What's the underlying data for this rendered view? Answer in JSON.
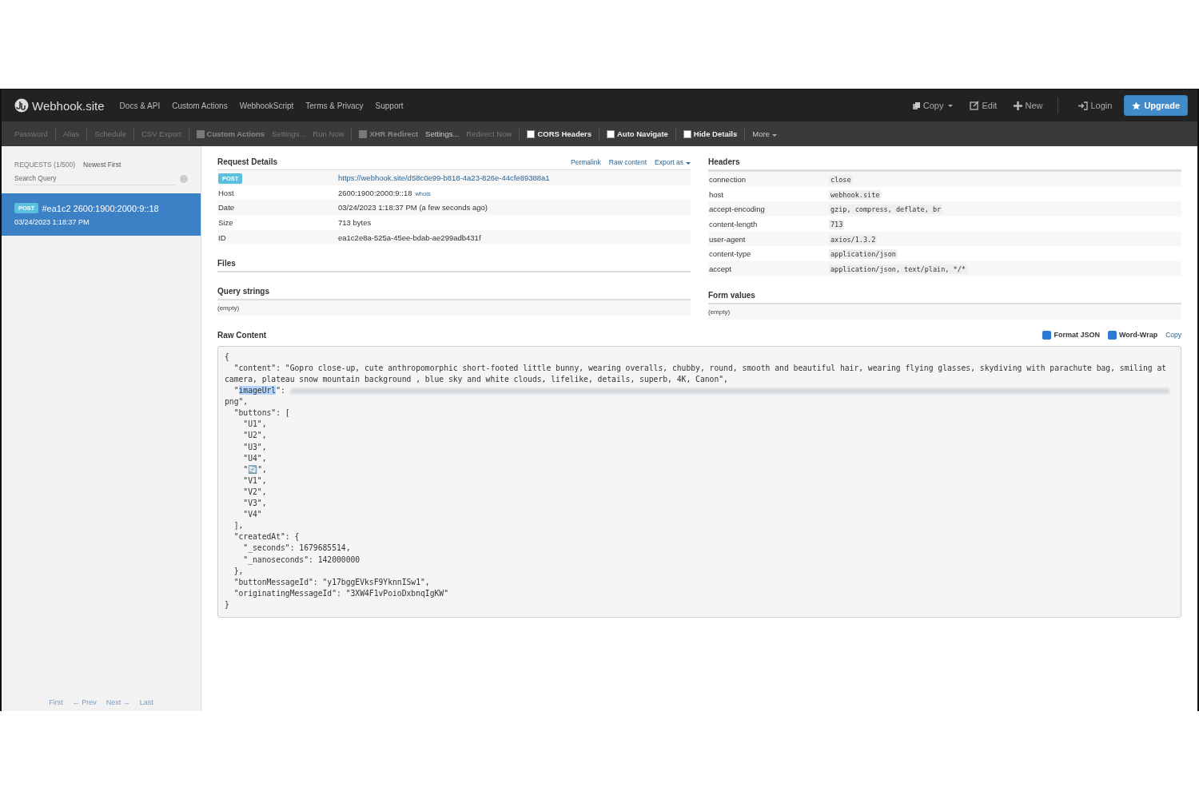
{
  "navbar": {
    "brand": "Webhook.site",
    "links": [
      "Docs & API",
      "Custom Actions",
      "WebhookScript",
      "Terms & Privacy",
      "Support"
    ],
    "actions": [
      {
        "kind": "copy",
        "label": "Copy",
        "caret": true
      },
      {
        "kind": "edit",
        "label": "Edit",
        "caret": false
      },
      {
        "kind": "new",
        "label": "New",
        "caret": false
      },
      {
        "kind": "login",
        "label": "Login",
        "caret": false
      }
    ],
    "upgrade": "Upgrade"
  },
  "toolbar": [
    {
      "kind": "link",
      "label": "Password",
      "disabled": true
    },
    {
      "kind": "sep"
    },
    {
      "kind": "link",
      "label": "Alias",
      "disabled": true
    },
    {
      "kind": "sep"
    },
    {
      "kind": "link",
      "label": "Schedule",
      "disabled": true
    },
    {
      "kind": "sep"
    },
    {
      "kind": "link",
      "label": "CSV Export",
      "disabled": true
    },
    {
      "kind": "sep"
    },
    {
      "kind": "checkbox",
      "label": "Custom Actions",
      "checked": false,
      "disabled": true
    },
    {
      "kind": "link",
      "label": "Settings...",
      "disabled": true
    },
    {
      "kind": "link",
      "label": "Run Now",
      "disabled": true
    },
    {
      "kind": "sep"
    },
    {
      "kind": "checkbox",
      "label": "XHR Redirect",
      "checked": false,
      "disabled": true
    },
    {
      "kind": "link",
      "label": "Settings...",
      "disabled": false
    },
    {
      "kind": "link",
      "label": "Redirect Now",
      "disabled": true
    },
    {
      "kind": "sep"
    },
    {
      "kind": "checkbox",
      "label": "CORS Headers",
      "checked": false,
      "disabled": false
    },
    {
      "kind": "sep"
    },
    {
      "kind": "checkbox",
      "label": "Auto Navigate",
      "checked": false,
      "disabled": false
    },
    {
      "kind": "sep"
    },
    {
      "kind": "checkbox",
      "label": "Hide Details",
      "checked": false,
      "disabled": false
    },
    {
      "kind": "sep"
    },
    {
      "kind": "dropdown",
      "label": "More",
      "disabled": false
    }
  ],
  "sidebar": {
    "count": "REQUESTS (1/500)",
    "sort": "Newest First",
    "search": {
      "placeholder": "Search Query"
    },
    "requests": [
      {
        "method": "POST",
        "title": "#ea1c2 2600:1900:2000:9::18",
        "time": "03/24/2023 1:18:37 PM",
        "selected": true
      }
    ],
    "pager": [
      "First",
      "← Prev",
      "Next →",
      "Last"
    ]
  },
  "request_details": {
    "title": "Request Details",
    "links": [
      {
        "label": "Permalink",
        "caret": false
      },
      {
        "label": "Raw content",
        "caret": false
      },
      {
        "label": "Export as",
        "caret": true
      }
    ],
    "method": "POST",
    "url": "https://webhook.site/d58c0e99-b818-4a23-826e-44cfe89388a1",
    "rows": [
      {
        "label": "Host",
        "value": "2600:1900:2000:9::18",
        "link": "whois"
      },
      {
        "label": "Date",
        "value": "03/24/2023 1:18:37 PM (a few seconds ago)"
      },
      {
        "label": "Size",
        "value": "713 bytes"
      },
      {
        "label": "ID",
        "value": "ea1c2e8a-525a-45ee-bdab-ae299adb431f"
      }
    ]
  },
  "files": {
    "title": "Files"
  },
  "query_strings": {
    "title": "Query strings",
    "empty": "(empty)"
  },
  "headers": {
    "title": "Headers",
    "rows": [
      {
        "name": "connection",
        "value": "close"
      },
      {
        "name": "host",
        "value": "webhook.site"
      },
      {
        "name": "accept-encoding",
        "value": "gzip, compress, deflate, br"
      },
      {
        "name": "content-length",
        "value": "713"
      },
      {
        "name": "user-agent",
        "value": "axios/1.3.2"
      },
      {
        "name": "content-type",
        "value": "application/json"
      },
      {
        "name": "accept",
        "value": "application/json, text/plain, */*"
      }
    ]
  },
  "form_values": {
    "title": "Form values",
    "empty": "(empty)"
  },
  "raw_content": {
    "title": "Raw Content",
    "options": [
      {
        "label": "Format JSON",
        "checked": true
      },
      {
        "label": "Word-Wrap",
        "checked": true
      }
    ],
    "copy": "Copy",
    "lines": [
      {
        "kind": "text",
        "text": "{"
      },
      {
        "kind": "text",
        "text": "  \"content\": \"Gopro close-up, cute anthropomorphic short-footed little bunny, wearing overalls, chubby, round, smooth and beautiful hair, wearing flying glasses, skydiving with parachute bag, smiling at camera, plateau snow mountain background , blue sky and white clouds, lifelike, details, superb, 4K, Canon\","
      },
      {
        "kind": "redacted",
        "pre": "  \"",
        "key": "imageUrl",
        "post": "\": ",
        "selected": true
      },
      {
        "kind": "text",
        "text": "png\","
      },
      {
        "kind": "text",
        "text": "  \"buttons\": ["
      },
      {
        "kind": "text",
        "text": "    \"U1\","
      },
      {
        "kind": "text",
        "text": "    \"U2\","
      },
      {
        "kind": "text",
        "text": "    \"U3\","
      },
      {
        "kind": "text",
        "text": "    \"U4\","
      },
      {
        "kind": "text",
        "text": "    \"🔄\","
      },
      {
        "kind": "text",
        "text": "    \"V1\","
      },
      {
        "kind": "text",
        "text": "    \"V2\","
      },
      {
        "kind": "text",
        "text": "    \"V3\","
      },
      {
        "kind": "text",
        "text": "    \"V4\""
      },
      {
        "kind": "text",
        "text": "  ],"
      },
      {
        "kind": "text",
        "text": "  \"createdAt\": {"
      },
      {
        "kind": "text",
        "text": "    \"_seconds\": 1679685514,"
      },
      {
        "kind": "text",
        "text": "    \"_nanoseconds\": 142000000"
      },
      {
        "kind": "text",
        "text": "  },"
      },
      {
        "kind": "text",
        "text": "  \"buttonMessageId\": \"y17bggEVksF9YknnISw1\","
      },
      {
        "kind": "text",
        "text": "  \"originatingMessageId\": \"3XW4F1vPoioDxbnqIgKW\""
      },
      {
        "kind": "text",
        "text": "}"
      }
    ]
  }
}
